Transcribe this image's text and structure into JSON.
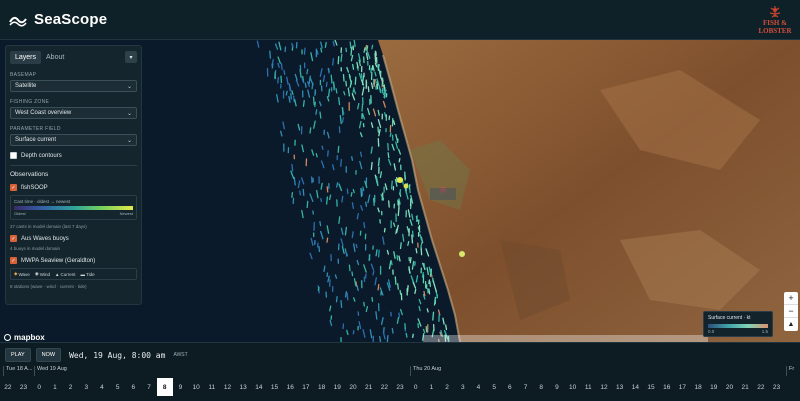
{
  "app": {
    "name": "SeaScope",
    "partner": [
      "FISH &",
      "LOBSTER"
    ]
  },
  "panel": {
    "tabs": [
      "Layers",
      "About"
    ],
    "active_tab": "Layers",
    "menu_icon": "chevron-down-icon",
    "basemap_label": "BASEMAP",
    "basemap_value": "Satellite",
    "zone_label": "FISHING ZONE",
    "zone_value": "West Coast overview",
    "param_label": "PARAMETER FIELD",
    "param_value": "Surface current",
    "depth_label": "Depth contours",
    "depth_checked": false,
    "observations_title": "Observations",
    "fishsoop_label": "fishSOOP",
    "fishsoop_checked": true,
    "cast_title": "Cast time · oldest → newest",
    "cast_oldest": "Oldest",
    "cast_newest": "Newest",
    "fishsoop_note": "27 casts in model domain (last 7 days)",
    "waves_label": "Aus Waves buoys",
    "waves_checked": true,
    "waves_note": "4 buoys in model domain",
    "mwpa_label": "MWPA Seaview (Geraldton)",
    "mwpa_checked": true,
    "legend": [
      "Wave",
      "Wind",
      "Current",
      "Tide"
    ],
    "mwpa_note": "8 stations (wave · wind · current · tide)"
  },
  "map": {
    "scale_title": "Surface current · kt",
    "scale_min": "0.0",
    "scale_max": "1.5",
    "zoom_in": "+",
    "zoom_out": "−",
    "compass": "▲",
    "attribution": "mapbox",
    "colors": {
      "ocean": "#0b1a2a",
      "land": "#8a5a34",
      "current_low": "#2e4d7b",
      "current_high": "#7fd5b8"
    }
  },
  "time": {
    "play_label": "PLAY",
    "now_label": "NOW",
    "current": "Wed, 19 Aug, 8:00 am",
    "tz": "AWST",
    "days": [
      "Tue 18 A...",
      "Wed 19 Aug",
      "Thu 20 Aug",
      "Fr"
    ],
    "hours": [
      "22",
      "23",
      "0",
      "1",
      "2",
      "3",
      "4",
      "5",
      "6",
      "7",
      "8",
      "9",
      "10",
      "11",
      "12",
      "13",
      "14",
      "15",
      "16",
      "17",
      "18",
      "19",
      "20",
      "21",
      "22",
      "23",
      "0",
      "1",
      "2",
      "3",
      "4",
      "5",
      "6",
      "7",
      "8",
      "9",
      "10",
      "11",
      "12",
      "13",
      "14",
      "15",
      "16",
      "17",
      "18",
      "19",
      "20",
      "21",
      "22",
      "23"
    ],
    "selected_hour_index": 10
  }
}
